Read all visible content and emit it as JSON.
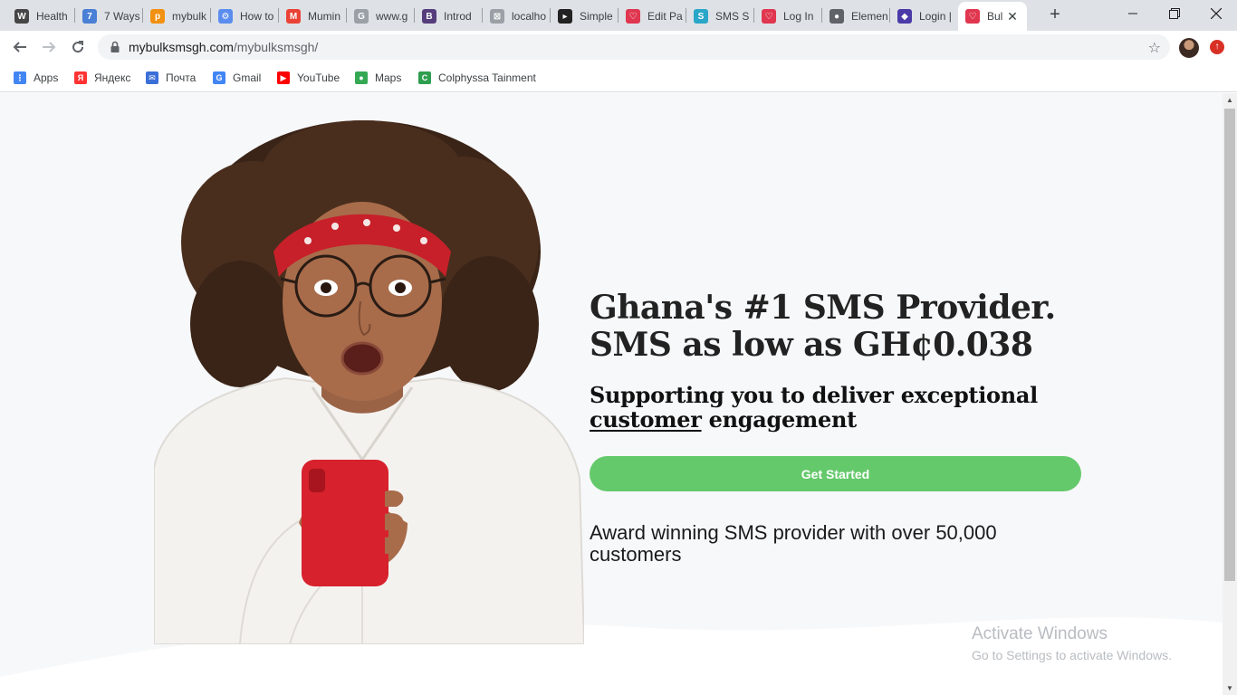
{
  "browser": {
    "tabs": [
      {
        "title": "Health",
        "icon": "wordpress-icon",
        "color": "#464646",
        "glyph": "W"
      },
      {
        "title": "7 Ways",
        "icon": "figure-icon",
        "color": "#4a7fd6",
        "glyph": "7"
      },
      {
        "title": "mybulk",
        "icon": "phpmyadmin-icon",
        "color": "#f29111",
        "glyph": "p"
      },
      {
        "title": "How to",
        "icon": "gear-icon",
        "color": "#5b8def",
        "glyph": "⚙"
      },
      {
        "title": "Mumin",
        "icon": "gmail-icon",
        "color": "#ea4335",
        "glyph": "M"
      },
      {
        "title": "www.g",
        "icon": "google-icon",
        "color": "#9aa0a6",
        "glyph": "G"
      },
      {
        "title": "Introd",
        "icon": "bootstrap-icon",
        "color": "#563d7c",
        "glyph": "B"
      },
      {
        "title": "localho",
        "icon": "broken-image-icon",
        "color": "#9aa0a6",
        "glyph": "⊠"
      },
      {
        "title": "Simple",
        "icon": "cursor-icon",
        "color": "#222222",
        "glyph": "▸"
      },
      {
        "title": "Edit Pa",
        "icon": "bulksms-icon",
        "color": "#e0364f",
        "glyph": "♡"
      },
      {
        "title": "SMS S",
        "icon": "sms-logo-icon",
        "color": "#2aa6c8",
        "glyph": "S"
      },
      {
        "title": "Log In",
        "icon": "bulksms-icon",
        "color": "#e0364f",
        "glyph": "♡"
      },
      {
        "title": "Elemen",
        "icon": "globe-icon",
        "color": "#5f6368",
        "glyph": "●"
      },
      {
        "title": "Login |",
        "icon": "login-icon",
        "color": "#4a3aa8",
        "glyph": "◆"
      },
      {
        "title": "Bul",
        "icon": "bulksms-icon",
        "color": "#e0364f",
        "glyph": "♡",
        "active": true
      }
    ],
    "address": {
      "domain": "mybulksmsgh.com",
      "path": "/mybulksmsgh/"
    },
    "bookmarks": [
      {
        "label": "Apps",
        "icon": "apps-grid-icon",
        "color": "#4285f4",
        "glyph": "⋮"
      },
      {
        "label": "Яндекс",
        "icon": "yandex-icon",
        "color": "#ff3333",
        "glyph": "Я"
      },
      {
        "label": "Почта",
        "icon": "mail-icon",
        "color": "#3b6fd8",
        "glyph": "✉"
      },
      {
        "label": "Gmail",
        "icon": "google-icon",
        "color": "#4285f4",
        "glyph": "G"
      },
      {
        "label": "YouTube",
        "icon": "youtube-icon",
        "color": "#ff0000",
        "glyph": "▶"
      },
      {
        "label": "Maps",
        "icon": "maps-pin-icon",
        "color": "#34a853",
        "glyph": "●"
      },
      {
        "label": "Colphyssa Tainment",
        "icon": "colphyssa-icon",
        "color": "#2e9e4f",
        "glyph": "C"
      }
    ]
  },
  "page": {
    "headline_1": "Ghana's #1 SMS Provider.",
    "headline_2": "SMS as low as GH¢0.038",
    "subhead_1": "Supporting you to deliver exceptional",
    "subhead_underlined": "customer",
    "subhead_2": " engagement",
    "cta_label": "Get Started",
    "tagline": "Award winning SMS provider with over 50,000 customers",
    "colors": {
      "cta": "#64c96b",
      "text": "#222222",
      "background": "#f7f8fa"
    }
  },
  "watermark": {
    "line1": "Activate Windows",
    "line2": "Go to Settings to activate Windows."
  }
}
